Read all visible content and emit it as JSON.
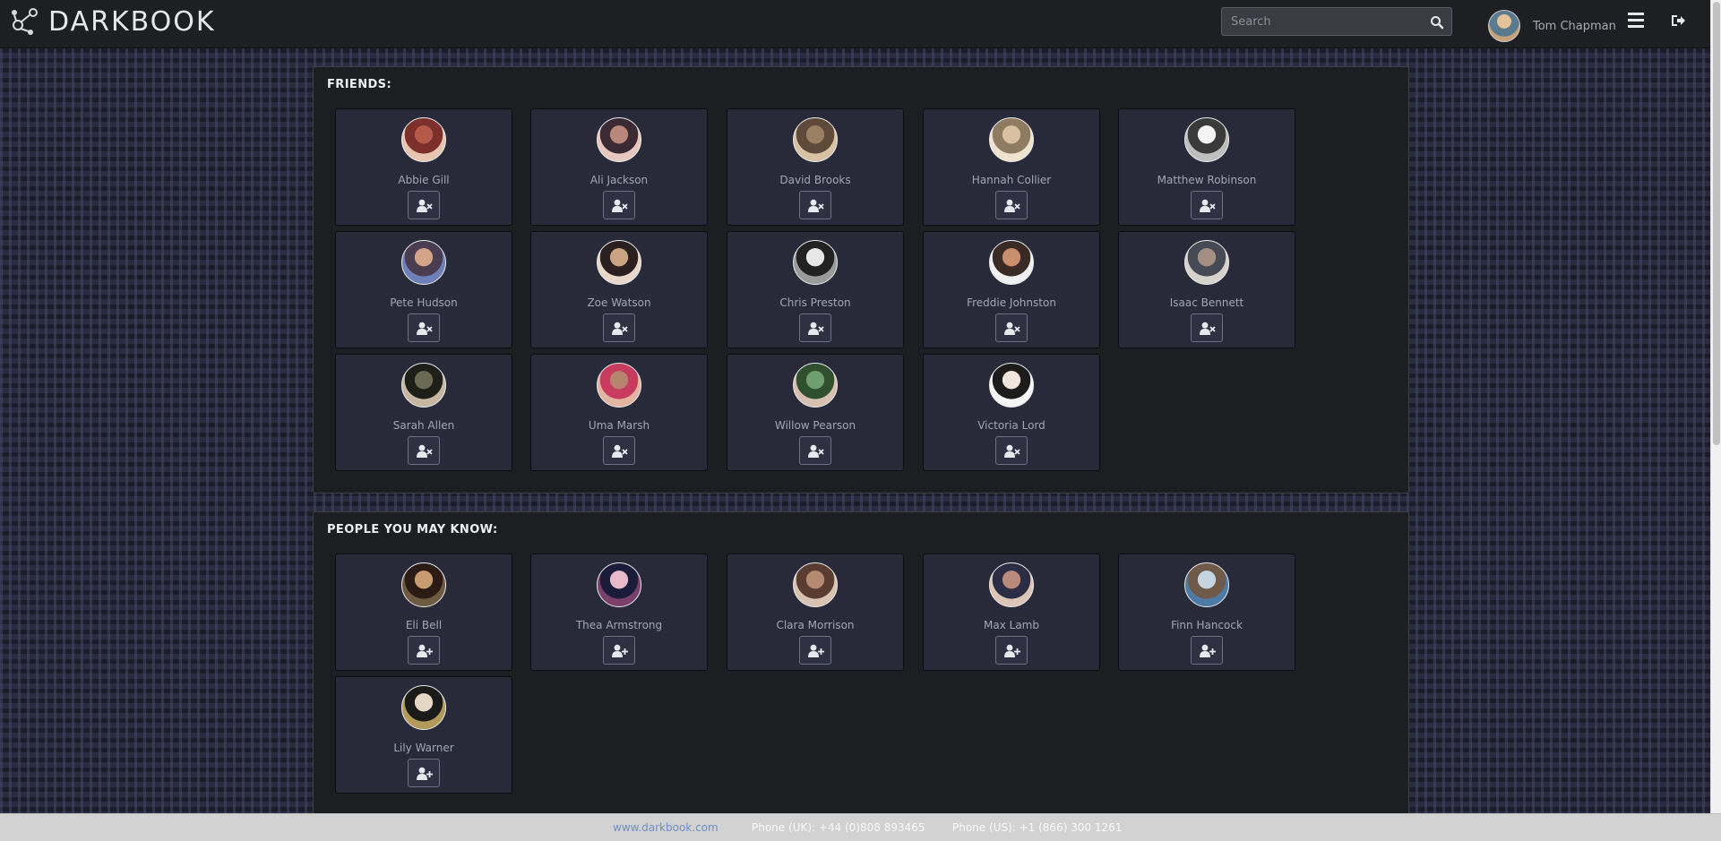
{
  "header": {
    "logo_text": "DARKBOOK",
    "search_placeholder": "Search",
    "user_name": "Tom Chapman"
  },
  "friends": {
    "title": "FRIENDS:",
    "items": [
      {
        "name": "Abbie Gill"
      },
      {
        "name": "Ali Jackson"
      },
      {
        "name": "David Brooks"
      },
      {
        "name": "Hannah Collier"
      },
      {
        "name": "Matthew Robinson"
      },
      {
        "name": "Pete Hudson"
      },
      {
        "name": "Zoe Watson"
      },
      {
        "name": "Chris Preston"
      },
      {
        "name": "Freddie Johnston"
      },
      {
        "name": "Isaac Bennett"
      },
      {
        "name": "Sarah Allen"
      },
      {
        "name": "Uma Marsh"
      },
      {
        "name": "Willow Pearson"
      },
      {
        "name": "Victoria Lord"
      }
    ]
  },
  "people": {
    "title": "PEOPLE YOU MAY KNOW:",
    "items": [
      {
        "name": "Eli Bell"
      },
      {
        "name": "Thea Armstrong"
      },
      {
        "name": "Clara Morrison"
      },
      {
        "name": "Max Lamb"
      },
      {
        "name": "Finn Hancock"
      },
      {
        "name": "Lily Warner"
      }
    ]
  },
  "footer": {
    "website": "www.darkbook.com",
    "phone_uk": "Phone (UK): +44 (0)808 893465",
    "phone_us": "Phone (US): +1 (866) 300 1261"
  },
  "icons": {
    "logo": "molecule-icon",
    "search": "search-icon",
    "menu": "hamburger-menu-icon",
    "logout": "sign-out-icon",
    "remove_friend": "user-times-icon",
    "add_friend": "user-plus-icon"
  },
  "colors": {
    "header_bg": "#1e1f22",
    "panel_bg": "#1d1e21",
    "card_bg": "#282a3a",
    "footer_bg": "#d2d2d2",
    "link": "#6f8fc7"
  }
}
